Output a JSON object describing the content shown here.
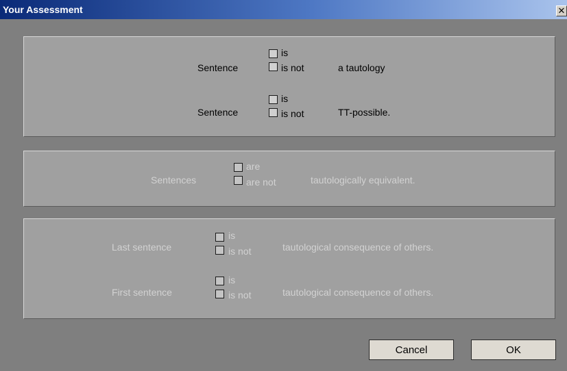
{
  "window": {
    "title": "Your Assessment",
    "close_glyph": "✕"
  },
  "panel1": {
    "rows": [
      {
        "prefix": "Sentence",
        "opt_a": "is",
        "opt_b": "is not",
        "suffix": "a tautology"
      },
      {
        "prefix": "Sentence",
        "opt_a": "is",
        "opt_b": "is not",
        "suffix": "TT-possible."
      }
    ]
  },
  "panel2": {
    "rows": [
      {
        "prefix": "Sentences",
        "opt_a": "are",
        "opt_b": "are not",
        "suffix": "tautologically equivalent."
      }
    ]
  },
  "panel3": {
    "rows": [
      {
        "prefix": "Last sentence",
        "opt_a": "is",
        "opt_b": "is not",
        "suffix": "tautological consequence of others."
      },
      {
        "prefix": "First sentence",
        "opt_a": "is",
        "opt_b": "is not",
        "suffix": "tautological consequence of others."
      }
    ]
  },
  "buttons": {
    "cancel": "Cancel",
    "ok": "OK"
  }
}
